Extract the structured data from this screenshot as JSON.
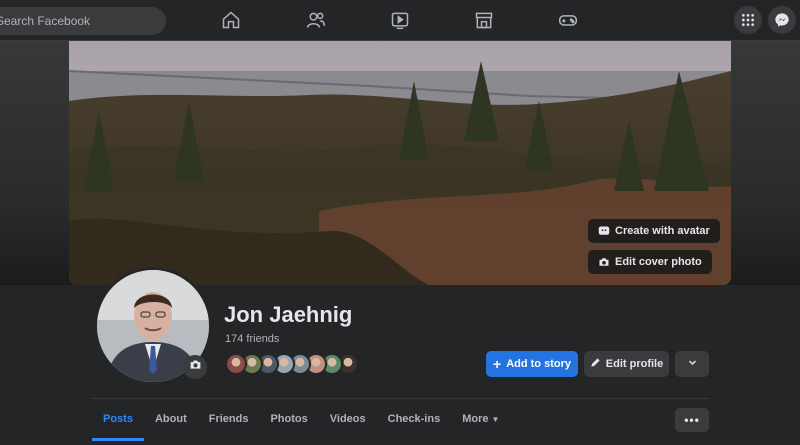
{
  "topbar": {
    "search_placeholder": "Search Facebook",
    "nav_icons": [
      "home-icon",
      "friends-icon",
      "watch-icon",
      "marketplace-icon",
      "gaming-icon"
    ],
    "right_icons": [
      "menu-grid-icon",
      "messenger-icon"
    ]
  },
  "cover": {
    "create_avatar_label": "Create with avatar",
    "edit_cover_label": "Edit cover photo"
  },
  "profile": {
    "name": "Jon Jaehnig",
    "friends_count": "174 friends",
    "friend_avatar_colors": [
      "#8a4b4b",
      "#6b7a4a",
      "#4a5a6a",
      "#9aa5b0",
      "#7a8a9a",
      "#c09080",
      "#5a8a6a",
      "#3a3030"
    ]
  },
  "actions": {
    "add_story_label": "Add to story",
    "edit_profile_label": "Edit profile"
  },
  "tabs": [
    {
      "label": "Posts",
      "active": true
    },
    {
      "label": "About",
      "active": false
    },
    {
      "label": "Friends",
      "active": false
    },
    {
      "label": "Photos",
      "active": false
    },
    {
      "label": "Videos",
      "active": false
    },
    {
      "label": "Check-ins",
      "active": false
    },
    {
      "label": "More",
      "active": false
    }
  ],
  "colors": {
    "accent": "#2374e1",
    "background": "#18191a",
    "surface": "#242526"
  }
}
